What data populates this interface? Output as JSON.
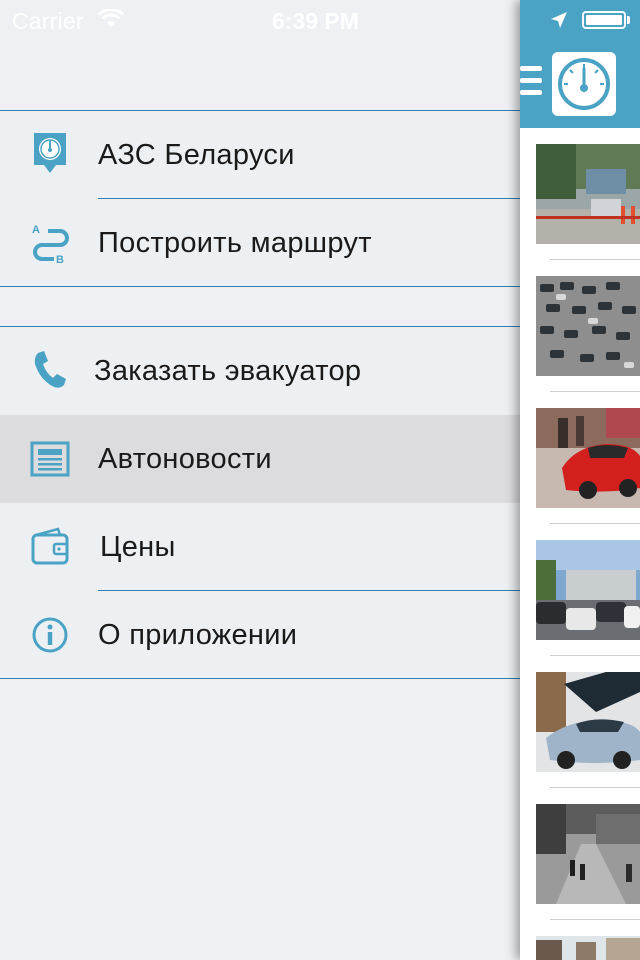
{
  "status_bar": {
    "carrier": "Carrier",
    "time": "6:39 PM"
  },
  "menu": {
    "group1": [
      {
        "label": "АЗС Беларуси",
        "icon": "fuel-gauge-pin-icon"
      },
      {
        "label": "Построить маршрут",
        "icon": "route-a-b-icon"
      }
    ],
    "group2": [
      {
        "label": "Заказать эвакуатор",
        "icon": "phone-icon"
      },
      {
        "label": "Автоновости",
        "icon": "newspaper-icon",
        "selected": true
      },
      {
        "label": "Цены",
        "icon": "wallet-icon"
      },
      {
        "label": "О приложении",
        "icon": "info-icon"
      }
    ]
  },
  "colors": {
    "accent": "#4aa2c4",
    "separator": "#2f7fb2",
    "menu_bg": "#edf0f2",
    "selected_bg": "#dcdcde",
    "icon": "#4aa2c4"
  },
  "news_thumbnails": [
    "highway-trucks-photo",
    "parking-lot-cars-photo",
    "red-car-showroom-photo",
    "street-traffic-photo",
    "silver-concept-car-photo",
    "road-pedestrians-bw-photo",
    "city-buildings-photo"
  ]
}
